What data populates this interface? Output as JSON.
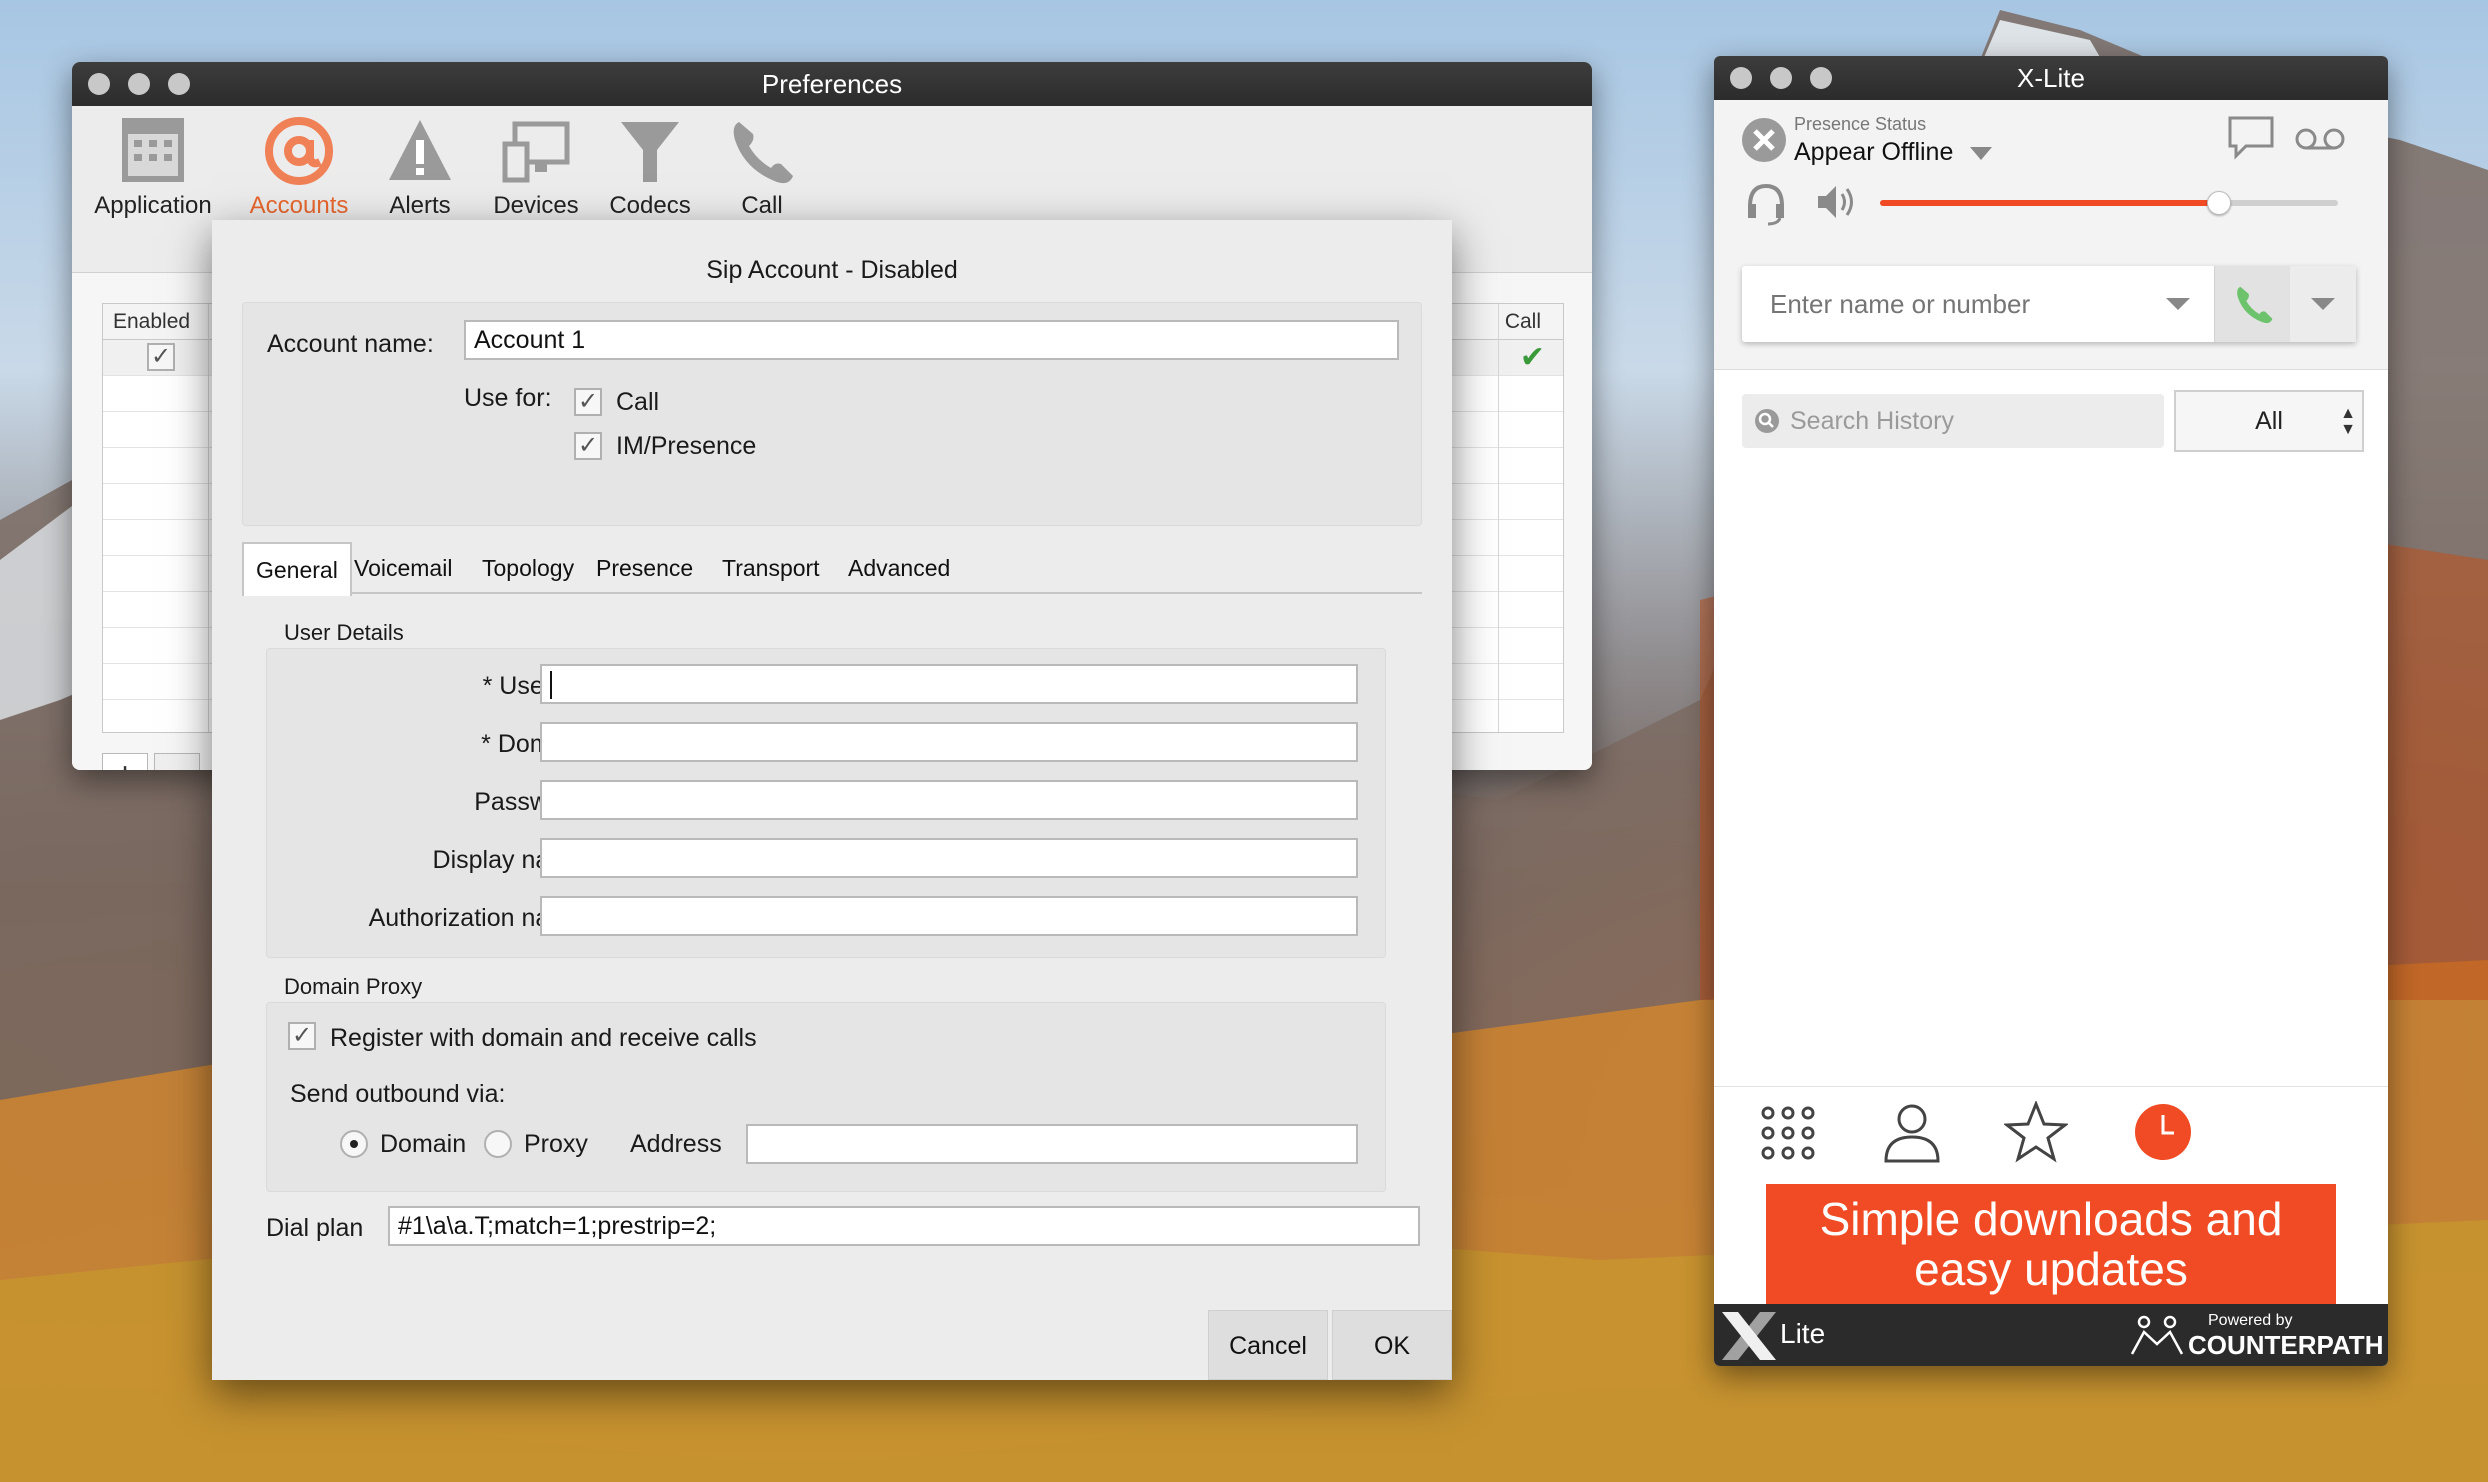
{
  "prefs": {
    "title": "Preferences",
    "toolbar": [
      {
        "label": "Application",
        "icon": "calendar-icon"
      },
      {
        "label": "Accounts",
        "icon": "at-sign-icon"
      },
      {
        "label": "Alerts",
        "icon": "warning-icon"
      },
      {
        "label": "Devices",
        "icon": "monitor-icon"
      },
      {
        "label": "Codecs",
        "icon": "filter-icon"
      },
      {
        "label": "Call",
        "icon": "phone-icon"
      }
    ],
    "table": {
      "col_enabled": "Enabled",
      "col_call": "Call"
    },
    "add_label": "+",
    "remove_label": "—"
  },
  "sip": {
    "title": "Sip Account - Disabled",
    "account_name_label": "Account name:",
    "account_name_value": "Account 1",
    "use_for_label": "Use for:",
    "use_for_call": "Call",
    "use_for_im": "IM/Presence",
    "tabs": [
      "General",
      "Voicemail",
      "Topology",
      "Presence",
      "Transport",
      "Advanced"
    ],
    "user_details_title": "User Details",
    "fields": [
      {
        "label": "* User ID",
        "value": ""
      },
      {
        "label": "* Domain",
        "value": ""
      },
      {
        "label": "Password",
        "value": ""
      },
      {
        "label": "Display name",
        "value": ""
      },
      {
        "label": "Authorization name",
        "value": ""
      }
    ],
    "domain_proxy_title": "Domain Proxy",
    "register_label": "Register with domain and receive calls",
    "send_outbound_label": "Send outbound via:",
    "radio_domain": "Domain",
    "radio_proxy": "Proxy",
    "address_label": "Address",
    "address_value": "",
    "dial_plan_label": "Dial plan",
    "dial_plan_value": "#1\\a\\a.T;match=1;prestrip=2;",
    "cancel_label": "Cancel",
    "ok_label": "OK"
  },
  "xlite": {
    "title": "X-Lite",
    "presence_caption": "Presence Status",
    "presence_value": "Appear Offline",
    "volume_level": 0.74,
    "dial_placeholder": "Enter name or number",
    "search_placeholder": "Search History",
    "filter_value": "All",
    "promo_line1": "Simple downloads and",
    "promo_line2": "easy updates",
    "footer_logo": "Lite",
    "footer_powered": "Powered by",
    "footer_brand": "COUNTERPATH",
    "accent": "#f04b24",
    "green": "#6cc36c"
  }
}
